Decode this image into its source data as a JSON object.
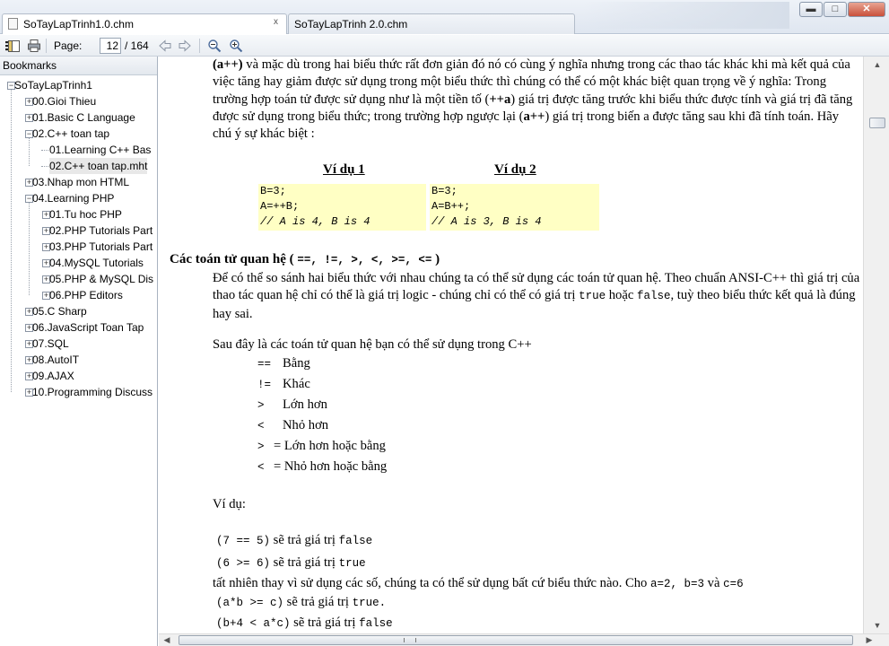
{
  "tabs": [
    {
      "label": "SoTayLapTrinh1.0.chm",
      "active": true
    },
    {
      "label": "SoTayLapTrinh 2.0.chm",
      "active": false
    }
  ],
  "window_controls": {
    "minimize": "▬",
    "maximize": "□",
    "close": "✕",
    "tab_close": "x"
  },
  "toolbar": {
    "page_label": "Page:",
    "page_value": "12",
    "page_total": "/ 164"
  },
  "sidebar": {
    "title": "Bookmarks",
    "items": [
      {
        "label": "SoTayLapTrinh1",
        "level": 0,
        "expander": "−"
      },
      {
        "label": "00.Gioi Thieu",
        "level": 1,
        "expander": "+"
      },
      {
        "label": "01.Basic C Language",
        "level": 1,
        "expander": "+"
      },
      {
        "label": "02.C++ toan tap",
        "level": 1,
        "expander": "−"
      },
      {
        "label": "01.Learning C++ Bas",
        "level": 2,
        "expander": ""
      },
      {
        "label": "02.C++ toan tap.mht",
        "level": 2,
        "expander": "",
        "selected": true
      },
      {
        "label": "03.Nhap mon HTML",
        "level": 1,
        "expander": "+"
      },
      {
        "label": "04.Learning PHP",
        "level": 1,
        "expander": "−"
      },
      {
        "label": "01.Tu hoc PHP",
        "level": 2,
        "expander": "+"
      },
      {
        "label": "02.PHP Tutorials Part",
        "level": 2,
        "expander": "+"
      },
      {
        "label": "03.PHP Tutorials Part",
        "level": 2,
        "expander": "+"
      },
      {
        "label": "04.MySQL Tutorials",
        "level": 2,
        "expander": "+"
      },
      {
        "label": "05.PHP & MySQL Dis",
        "level": 2,
        "expander": "+"
      },
      {
        "label": "06.PHP Editors",
        "level": 2,
        "expander": "+"
      },
      {
        "label": "05.C Sharp",
        "level": 1,
        "expander": "+"
      },
      {
        "label": "06.JavaScript Toan Tap",
        "level": 1,
        "expander": "+"
      },
      {
        "label": "07.SQL",
        "level": 1,
        "expander": "+"
      },
      {
        "label": "08.AutoIT",
        "level": 1,
        "expander": "+"
      },
      {
        "label": "09.AJAX",
        "level": 1,
        "expander": "+"
      },
      {
        "label": "10.Programming Discuss",
        "level": 1,
        "expander": "+"
      }
    ]
  },
  "content": {
    "intro": {
      "p1": "(a++)",
      "p2": " và mặc dù trong hai biểu thức rất đơn giản đó nó có cùng ý nghĩa nhưng trong các thao tác khác khi mà kết quả của việc tăng hay giảm được sử dụng trong một biểu thức thì chúng có thể có một khác biệt quan trọng về ý nghĩa: Trong trường hợp toán tử được sử dụng như là một tiền tố (",
      "p3": "++a",
      "p4": ") giá trị được tăng trước khi biểu thức được tính và giá trị đã tăng được sử dụng trong biểu thức; trong trường hợp ngược lại (",
      "p5": "a++",
      "p6": ") giá trị trong biến a được tăng sau khi đã tính toán. Hãy chú ý sự khác biệt :"
    },
    "example1": {
      "title": "Ví dụ 1",
      "lines": [
        "B=3;",
        "A=++B;",
        "// A is 4, B is 4"
      ]
    },
    "example2": {
      "title": "Ví dụ 2",
      "lines": [
        "B=3;",
        "A=B++;",
        "// A is 3, B is 4"
      ]
    },
    "section": {
      "title_prefix": "Các toán tử quan hệ ( ",
      "ops": "==, !=, >, <, >=, <=",
      "title_suffix": " )"
    },
    "relational_para": {
      "a": "Để có thể so sánh hai biểu thức với nhau chúng ta có thể sử dụng các toán tử quan hệ. Theo chuẩn ANSI-C++ thì giá trị của thao tác quan hệ chỉ có thể là giá trị logic - chúng chỉ có thể có giá trị ",
      "true": "true",
      "b": " hoặc ",
      "false": "false",
      "c": ", tuỳ theo biểu thức kết quả là đúng hay sai."
    },
    "list_intro": "Sau đây là các toán tử quan hệ bạn có thể sử dụng trong C++",
    "operators": [
      {
        "op": "==",
        "desc": "Bằng"
      },
      {
        "op": "!=",
        "desc": "Khác"
      },
      {
        "op": ">",
        "desc": "Lớn hơn"
      },
      {
        "op": "<",
        "desc": "Nhỏ hơn"
      },
      {
        "op": ">",
        "desc": "= Lớn hơn hoặc bằng"
      },
      {
        "op": "<",
        "desc": "= Nhỏ hơn hoặc bằng"
      }
    ],
    "example_label": "Ví dụ:",
    "examples": [
      {
        "code": "(7 == 5)",
        "text": " sẽ trả giá trị ",
        "result": "false"
      },
      {
        "code": "(6 >= 6)",
        "text": " sẽ trả giá trị ",
        "result": "true"
      }
    ],
    "vars_note": {
      "a": "tất nhiên thay vì sử dụng các số, chúng ta có thể sử dụng bất cứ biểu thức nào. Cho ",
      "vals": "a=2, b=3",
      "b": " và ",
      "c_val": "c=6"
    },
    "examples2": [
      {
        "code": "(a*b >= c)",
        "text": "  sẽ trả giá trị ",
        "result": "true."
      },
      {
        "code": "(b+4 < a*c)",
        "text": " sẽ trả giá trị ",
        "result": "false"
      }
    ]
  }
}
